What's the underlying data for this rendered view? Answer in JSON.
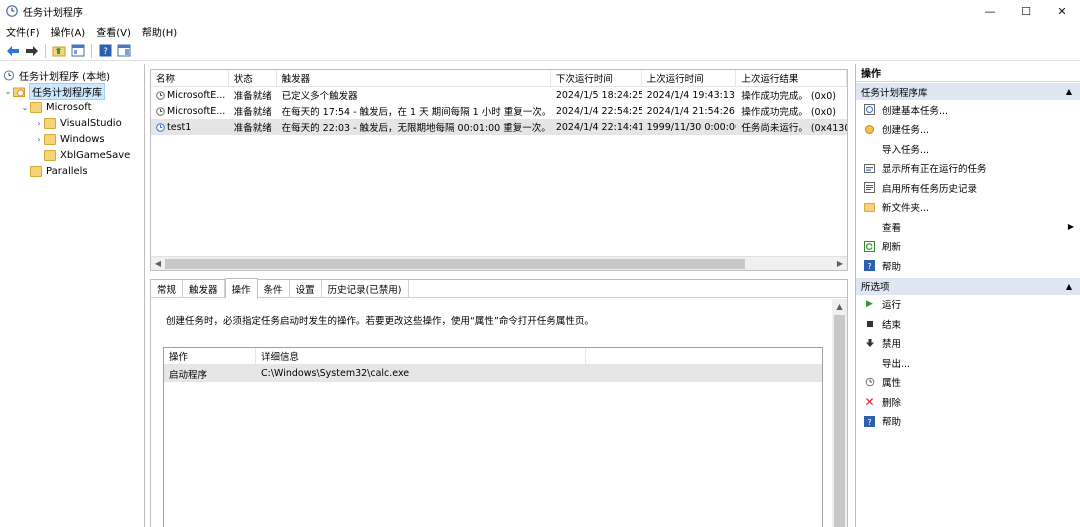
{
  "window": {
    "title": "任务计划程序",
    "controls": {
      "minimize": "—",
      "maximize": "☐",
      "close": "✕"
    }
  },
  "menu": [
    "文件(F)",
    "操作(A)",
    "查看(V)",
    "帮助(H)"
  ],
  "tree": [
    {
      "label": "任务计划程序 (本地)",
      "level": 0
    },
    {
      "label": "任务计划程序库",
      "level": 1,
      "selected": true
    },
    {
      "label": "Microsoft",
      "level": 2
    },
    {
      "label": "VisualStudio",
      "level": 3
    },
    {
      "label": "Windows",
      "level": 3
    },
    {
      "label": "XblGameSave",
      "level": 3
    },
    {
      "label": "Parallels",
      "level": 2
    }
  ],
  "task_list": {
    "columns": [
      "名称",
      "状态",
      "触发器",
      "下次运行时间",
      "上次运行时间",
      "上次运行结果"
    ],
    "rows": [
      [
        "MicrosoftE...",
        "准备就绪",
        "已定义多个触发器",
        "2024/1/5 18:24:25",
        "2024/1/4 19:43:13",
        "操作成功完成。 (0x0)"
      ],
      [
        "MicrosoftE...",
        "准备就绪",
        "在每天的 17:54 - 触发后，在 1 天 期间每隔 1 小时 重复一次。",
        "2024/1/4 22:54:25",
        "2024/1/4 21:54:26",
        "操作成功完成。 (0x0)"
      ],
      [
        "test1",
        "准备就绪",
        "在每天的 22:03 - 触发后，无限期地每隔 00:01:00 重复一次。",
        "2024/1/4 22:14:41",
        "1999/11/30 0:00:00",
        "任务尚未运行。 (0x4130"
      ]
    ]
  },
  "details": {
    "tabs": [
      "常规",
      "触发器",
      "操作",
      "条件",
      "设置",
      "历史记录(已禁用)"
    ],
    "active_tab": "操作",
    "description": "创建任务时，必须指定任务启动时发生的操作。若要更改这些操作，使用“属性”命令打开任务属性页。",
    "action_table": {
      "columns": [
        "操作",
        "详细信息"
      ],
      "rows": [
        [
          "启动程序",
          "C:\\Windows\\System32\\calc.exe"
        ]
      ]
    }
  },
  "actions_pane": {
    "title": "操作",
    "section1": {
      "title": "任务计划程序库",
      "items": [
        "创建基本任务...",
        "创建任务...",
        "导入任务...",
        "显示所有正在运行的任务",
        "启用所有任务历史记录",
        "新文件夹...",
        "查看",
        "刷新",
        "帮助"
      ]
    },
    "section2": {
      "title": "所选项",
      "items": [
        "运行",
        "结束",
        "禁用",
        "导出...",
        "属性",
        "删除",
        "帮助"
      ]
    }
  }
}
